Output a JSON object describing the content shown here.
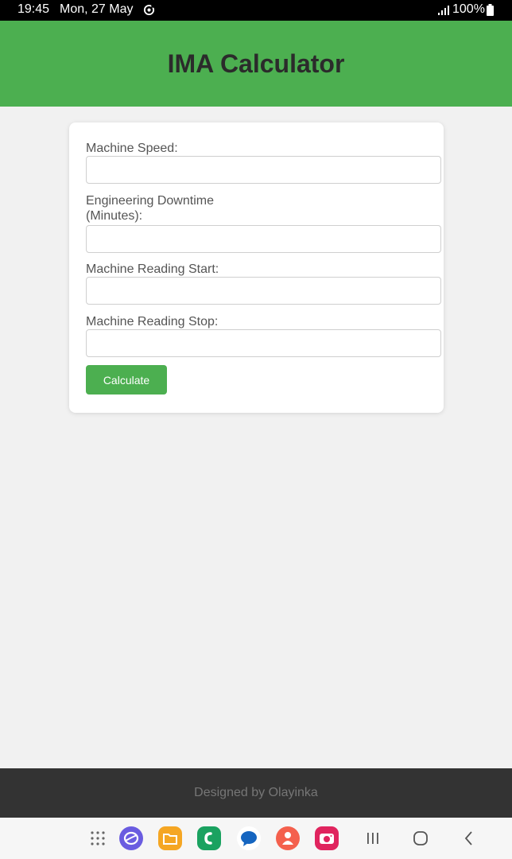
{
  "status_bar": {
    "time": "19:45",
    "date": "Mon, 27 May",
    "battery": "100%"
  },
  "header": {
    "title": "IMA Calculator"
  },
  "form": {
    "fields": [
      {
        "label": "Machine Speed:",
        "value": ""
      },
      {
        "label": "Engineering Downtime\n(Minutes):",
        "value": ""
      },
      {
        "label": "Machine Reading Start:",
        "value": ""
      },
      {
        "label": "Machine Reading Stop:",
        "value": ""
      }
    ],
    "calculate_label": "Calculate"
  },
  "footer": {
    "text": "Designed by Olayinka"
  },
  "nav_bar": {
    "apps": [
      "app-drawer-icon",
      "internet-browser-icon",
      "my-files-icon",
      "phone-icon",
      "messages-icon",
      "contacts-icon",
      "camera-icon"
    ],
    "system": [
      "recents-icon",
      "home-icon",
      "back-icon"
    ]
  },
  "colors": {
    "accent": "#4caf50",
    "footer_bg": "#333333",
    "page_bg": "#f1f1f1"
  }
}
